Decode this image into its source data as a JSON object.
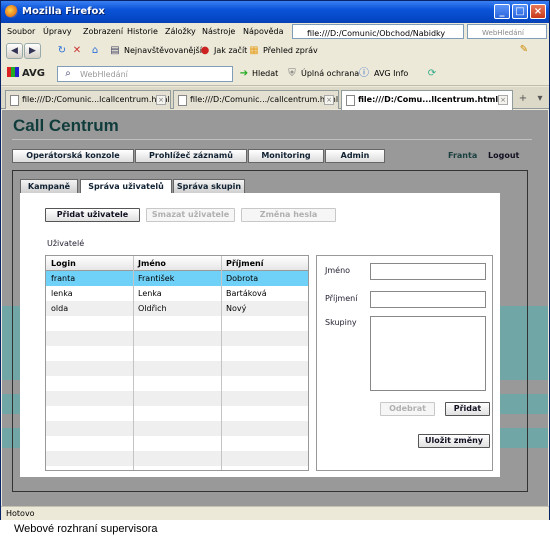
{
  "window": {
    "title": "Mozilla Firefox",
    "status": "Hotovo"
  },
  "menu": {
    "items": [
      "Soubor",
      "Úpravy",
      "Zobrazení",
      "Historie",
      "Záložky",
      "Nástroje",
      "Nápověda"
    ],
    "url": "file:///D:/Comunic/Obchod/Nabidky",
    "search_placeholder": "WebHledání"
  },
  "bookmarks": {
    "items": [
      "Nejnavštěvovanější",
      "Jak začít",
      "Přehled zpráv"
    ]
  },
  "avg": {
    "logo": "AVG",
    "search_placeholder": "WebHledání",
    "buttons": [
      "Hledat",
      "Úplná ochrana",
      "AVG Info"
    ]
  },
  "tabs": [
    {
      "label": "file:///D:/Comunic...lcallcentrum.html",
      "active": false
    },
    {
      "label": "file:///D:/Comunic.../callcentrum.html",
      "active": false
    },
    {
      "label": "file:///D:/Comu...llcentrum.html",
      "active": true
    }
  ],
  "app": {
    "title": "Call Centrum",
    "nav": [
      "Operátorská konzole",
      "Prohlížeč záznamů",
      "Monitoring",
      "Admin"
    ],
    "user": "Franta",
    "logout": "Logout",
    "subtabs": [
      "Kampaně",
      "Správa uživatelů",
      "Správa skupin"
    ],
    "buttons": {
      "add_user": "Přidat uživatele",
      "delete_user": "Smazat uživatele",
      "change_password": "Změna hesla"
    },
    "users_label": "Uživatelé",
    "table": {
      "headers": [
        "Login",
        "Jméno",
        "Příjmení"
      ],
      "rows": [
        [
          "franta",
          "František",
          "Dobrota"
        ],
        [
          "lenka",
          "Lenka",
          "Bartáková"
        ],
        [
          "olda",
          "Oldřich",
          "Nový"
        ]
      ]
    },
    "form": {
      "name_label": "Jméno",
      "surname_label": "Příjmení",
      "groups_label": "Skupiny",
      "remove_button": "Odebrat",
      "add_button": "Přidat",
      "save_button": "Uložit změny"
    }
  },
  "caption": "Webové rozhraní supervisora",
  "colors": {
    "selected_row": "#6fd1f8",
    "teal_band": "#71a6a6",
    "page_gray": "#999999"
  }
}
